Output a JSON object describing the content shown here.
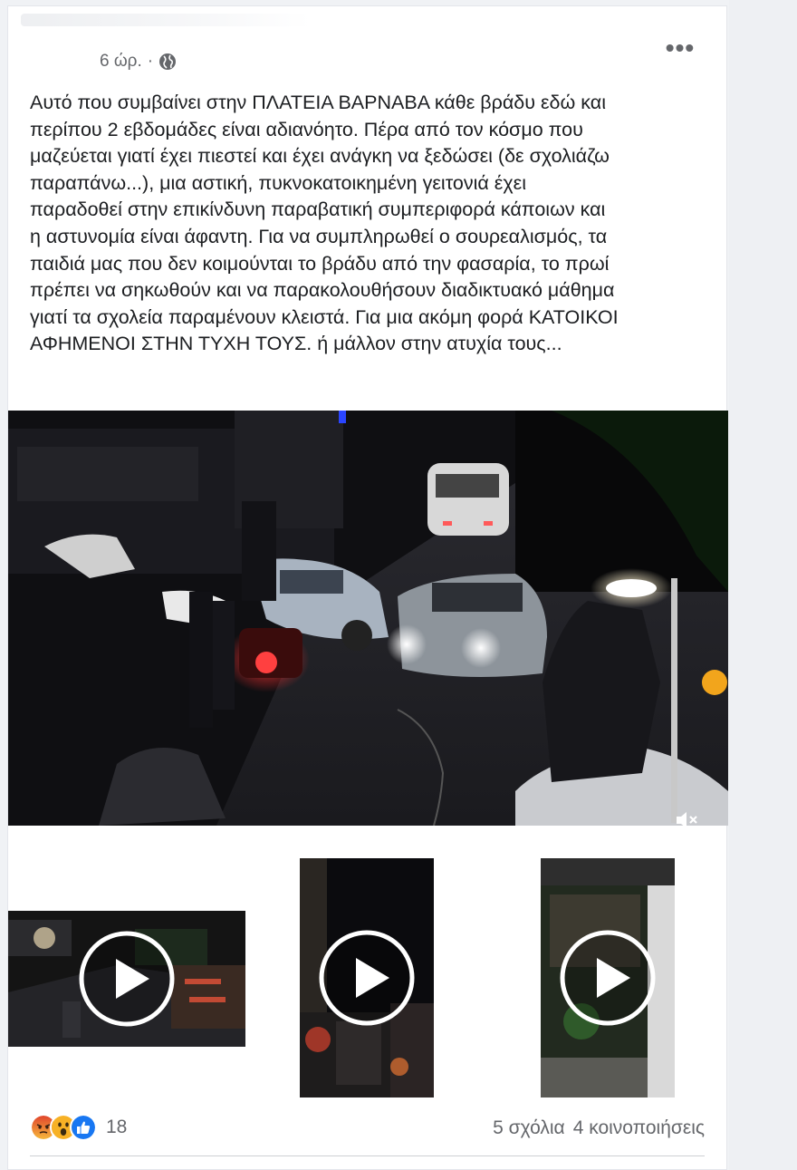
{
  "post": {
    "time": "6 ώρ.",
    "separator": "·",
    "privacy_icon": "globe-icon",
    "more_icon": "more-options-icon",
    "more_label": "•••",
    "text": "Αυτό που συμβαίνει στην ΠΛΑΤΕΙΑ ΒΑΡΝΑΒΑ κάθε βράδυ εδώ και\nπερίπου 2 εβδομάδες είναι αδιανόητο. Πέρα από τον κόσμο που\nμαζεύεται γιατί έχει πιεστεί και έχει ανάγκη να ξεδώσει (δε σχολιάζω\nπαραπάνω...), μια αστική, πυκνοκατοικημένη γειτονιά έχει\nπαραδοθεί στην επικίνδυνη παραβατική συμπεριφορά κάποιων και\nη αστυνομία είναι άφαντη. Για να συμπληρωθεί ο σουρεαλισμός, τα\nπαιδιά μας που δεν κοιμούνται το βράδυ από την φασαρία, το πρωί\nπρέπει να σηκωθούν και να παρακολουθήσουν διαδικτυακό μάθημα\nγιατί τα σχολεία παραμένουν κλειστά. Για μια ακόμη φορά ΚΑΤΟΙΚΟΙ\nΑΦΗΜΕΝΟΙ ΣΤΗΝ ΤΥΧΗ ΤΟΥΣ. ή μάλλον στην ατυχία τους..."
  },
  "main_video": {
    "mute_icon": "volume-muted-icon"
  },
  "thumbnails": [
    {
      "name": "video-thumbnail-1",
      "icon": "play-icon"
    },
    {
      "name": "video-thumbnail-2",
      "icon": "play-icon"
    },
    {
      "name": "video-thumbnail-3",
      "icon": "play-icon"
    }
  ],
  "footer": {
    "reactions": [
      "angry-reaction-icon",
      "wow-reaction-icon",
      "like-reaction-icon"
    ],
    "reaction_count": "18",
    "comments": "5 σχόλια",
    "shares": "4 κοινοποιήσεις"
  },
  "colors": {
    "text": "#1c1e21",
    "meta": "#65676b",
    "like": "#1877f2",
    "angry": "#e9710f",
    "wow": "#f7b125"
  }
}
